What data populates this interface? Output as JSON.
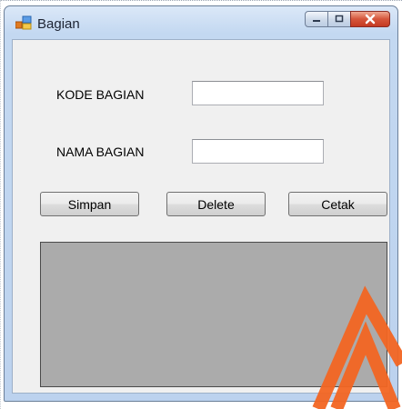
{
  "window": {
    "title": "Bagian",
    "buttons": {
      "minimize": "minimize-icon",
      "maximize": "maximize-icon",
      "close": "close-icon"
    }
  },
  "form": {
    "kode_label": "KODE BAGIAN",
    "kode_value": "",
    "nama_label": "NAMA BAGIAN",
    "nama_value": ""
  },
  "actions": {
    "simpan": "Simpan",
    "delete": "Delete",
    "cetak": "Cetak"
  },
  "colors": {
    "close_button": "#d5553b",
    "grid_background": "#ababab",
    "watermark": "#f26522"
  }
}
